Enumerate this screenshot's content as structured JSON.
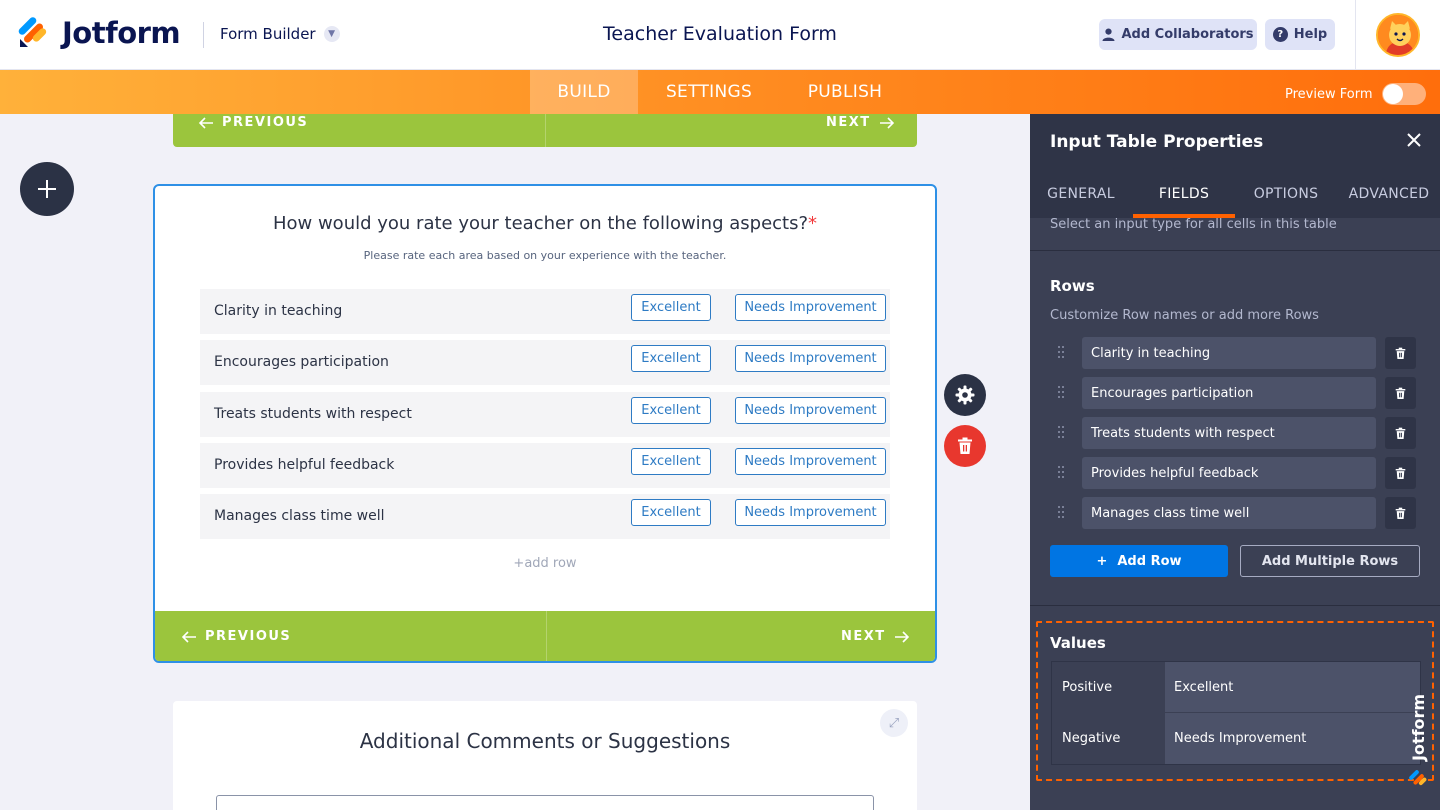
{
  "header": {
    "logo_text": "Jotform",
    "product": "Form Builder",
    "form_title": "Teacher Evaluation Form",
    "add_collaborators": "Add Collaborators",
    "help": "Help"
  },
  "nav": {
    "tabs": [
      {
        "label": "BUILD",
        "active": true
      },
      {
        "label": "SETTINGS",
        "active": false
      },
      {
        "label": "PUBLISH",
        "active": false
      }
    ],
    "preview_label": "Preview Form",
    "preview_on": false
  },
  "canvas": {
    "pager_top": {
      "previous": "PREVIOUS",
      "next": "NEXT"
    },
    "question": {
      "title": "How would you rate your teacher on the following aspects?",
      "required_mark": "*",
      "subtitle": "Please rate each area based on your experience with the teacher.",
      "rows": [
        {
          "label": "Clarity in teaching",
          "positive": "Excellent",
          "negative": "Needs Improvement"
        },
        {
          "label": "Encourages participation",
          "positive": "Excellent",
          "negative": "Needs Improvement"
        },
        {
          "label": "Treats students with respect",
          "positive": "Excellent",
          "negative": "Needs Improvement"
        },
        {
          "label": "Provides helpful feedback",
          "positive": "Excellent",
          "negative": "Needs Improvement"
        },
        {
          "label": "Manages class time well",
          "positive": "Excellent",
          "negative": "Needs Improvement"
        }
      ],
      "add_row": "+add row"
    },
    "pager": {
      "previous": "PREVIOUS",
      "next": "NEXT"
    },
    "next_question": {
      "title": "Additional Comments or Suggestions"
    }
  },
  "panel": {
    "title": "Input Table Properties",
    "tabs": [
      {
        "label": "GENERAL",
        "active": false
      },
      {
        "label": "FIELDS",
        "active": true
      },
      {
        "label": "OPTIONS",
        "active": false
      },
      {
        "label": "ADVANCED",
        "active": false
      }
    ],
    "input_type_desc": "Select an input type for all cells in this table",
    "rows_label": "Rows",
    "rows_desc": "Customize Row names or add more Rows",
    "rows": [
      "Clarity in teaching",
      "Encourages participation",
      "Treats students with respect",
      "Provides helpful feedback",
      "Manages class time well"
    ],
    "add_row_button": "Add Row",
    "add_row_plus": "+",
    "add_multiple_rows_button": "Add Multiple Rows",
    "values_label": "Values",
    "values": [
      {
        "key": "Positive",
        "value": "Excellent"
      },
      {
        "key": "Negative",
        "value": "Needs Improvement"
      }
    ]
  },
  "colors": {
    "brand_orange": "#ff6100",
    "pager_green": "#9bc53d",
    "selection_blue": "#2e90e6",
    "panel_bg": "#3b4054",
    "add_row_blue": "#0075e3",
    "delete_red": "#e8372e"
  },
  "icons": {
    "add_element": "plus-icon",
    "settings": "gear-icon",
    "delete": "trash-icon",
    "close": "close-icon",
    "expand": "expand-icon",
    "drag": "drag-handle-icon",
    "user": "user-icon",
    "help": "question-icon",
    "chevron": "chevron-down-icon"
  }
}
